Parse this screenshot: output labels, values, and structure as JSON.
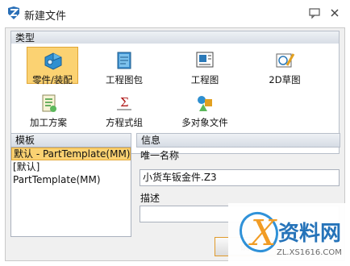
{
  "window": {
    "title": "新建文件",
    "help_icon": "speech-bubble-icon",
    "close_icon": "close-icon"
  },
  "type_section": {
    "header": "类型",
    "items": [
      {
        "label": "零件/装配",
        "icon": "part-assembly-icon",
        "selected": true
      },
      {
        "label": "工程图包",
        "icon": "drawing-package-icon",
        "selected": false
      },
      {
        "label": "工程图",
        "icon": "drawing-icon",
        "selected": false
      },
      {
        "label": "2D草图",
        "icon": "sketch-2d-icon",
        "selected": false
      },
      {
        "label": "加工方案",
        "icon": "machining-plan-icon",
        "selected": false
      },
      {
        "label": "方程式组",
        "icon": "equation-set-icon",
        "selected": false
      },
      {
        "label": "多对象文件",
        "icon": "multi-object-file-icon",
        "selected": false
      }
    ]
  },
  "template_section": {
    "header": "模板",
    "items": [
      {
        "label": "默认 - PartTemplate(MM)",
        "selected": true
      },
      {
        "label": "[默认]",
        "selected": false
      },
      {
        "label": "PartTemplate(MM)",
        "selected": false
      }
    ]
  },
  "info_section": {
    "header": "信息",
    "unique_name_label": "唯一名称",
    "unique_name_value": "小货车钣金件.Z3",
    "description_label": "描述",
    "description_value": ""
  },
  "buttons": {
    "ok_label": "确"
  },
  "watermark": {
    "site_name": "资料网",
    "site_url": "ZL.XS1616.COM"
  },
  "colors": {
    "selection": "#fbd272",
    "header_gradient_end": "#d6dce5"
  }
}
